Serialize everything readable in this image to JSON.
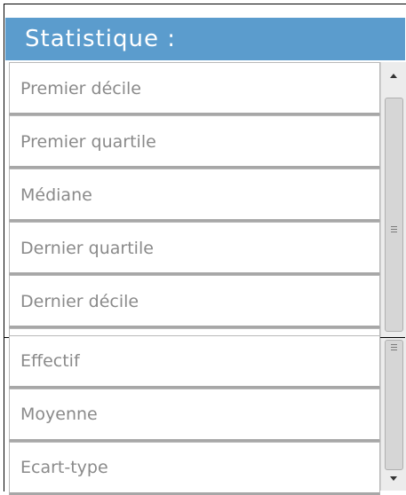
{
  "header": {
    "title": "Statistique :"
  },
  "list_top": {
    "items": [
      {
        "label": "Premier décile"
      },
      {
        "label": "Premier quartile"
      },
      {
        "label": "Médiane"
      },
      {
        "label": "Dernier quartile"
      },
      {
        "label": "Dernier décile"
      }
    ]
  },
  "list_bottom": {
    "items": [
      {
        "label": "Effectif"
      },
      {
        "label": "Moyenne"
      },
      {
        "label": "Ecart-type"
      }
    ]
  },
  "colors": {
    "header_bg": "#5b9ccd",
    "item_text": "#8a8a8a",
    "item_border": "#b9b9b9"
  },
  "icons": {
    "scroll_up": "scroll-up-arrow-icon",
    "scroll_down": "scroll-down-arrow-icon",
    "grip": "scroll-grip-icon"
  }
}
